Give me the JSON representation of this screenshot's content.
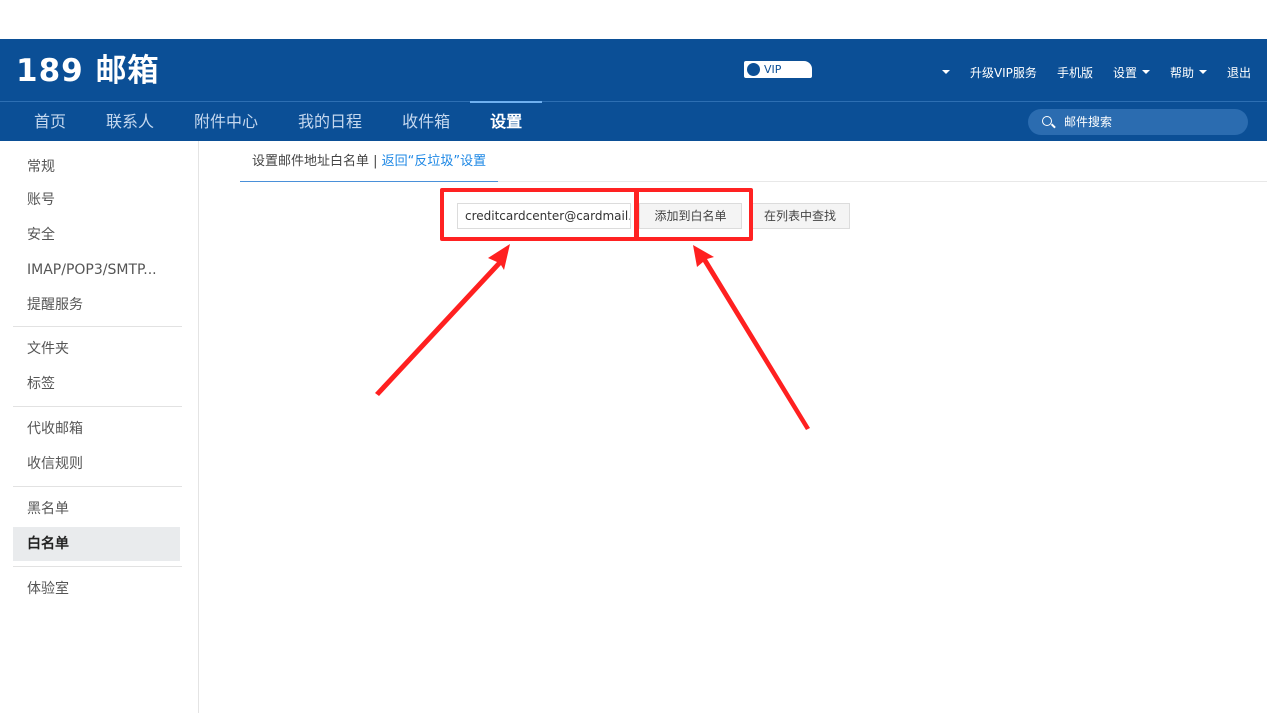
{
  "header": {
    "logo": "189 邮箱",
    "vip_label": "VIP",
    "links": {
      "upgrade": "升级VIP服务",
      "mobile": "手机版",
      "settings": "设置",
      "help": "帮助",
      "logout": "退出"
    }
  },
  "nav": {
    "tabs": [
      {
        "label": "首页"
      },
      {
        "label": "联系人"
      },
      {
        "label": "附件中心"
      },
      {
        "label": "我的日程"
      },
      {
        "label": "收件箱"
      },
      {
        "label": "设置"
      }
    ],
    "active_tab": "设置",
    "search_placeholder": "邮件搜索"
  },
  "sidebar": {
    "items": [
      {
        "label": "常规"
      },
      {
        "label": "账号"
      },
      {
        "label": "安全"
      },
      {
        "label": "IMAP/POP3/SMTP..."
      },
      {
        "label": "提醒服务"
      },
      {
        "label": "文件夹"
      },
      {
        "label": "标签"
      },
      {
        "label": "代收邮箱"
      },
      {
        "label": "收信规则"
      },
      {
        "label": "黑名单"
      },
      {
        "label": "白名单"
      },
      {
        "label": "体验室"
      }
    ],
    "active_item": "白名单"
  },
  "content": {
    "tab_title": "设置邮件地址白名单 | ",
    "tab_link": "返回“反垃圾”设置",
    "email_input_value": "creditcardcenter@cardmail.psbc.com",
    "add_button": "添加到白名单",
    "find_button": "在列表中查找"
  },
  "colors": {
    "header_bg": "#0b4f96",
    "highlight": "#ff2222",
    "link": "#1e88e5"
  }
}
